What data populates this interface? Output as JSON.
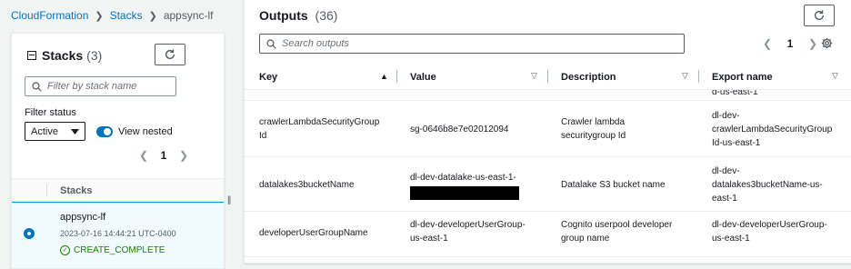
{
  "breadcrumb": {
    "root": "CloudFormation",
    "middle": "Stacks",
    "current": "appsync-lf"
  },
  "stacks_panel": {
    "title": "Stacks",
    "count": "(3)",
    "search_placeholder": "Filter by stack name",
    "filter_status_label": "Filter status",
    "filter_status_value": "Active",
    "view_nested_label": "View nested",
    "view_nested_on": true,
    "page_number": "1",
    "column_header": "Stacks",
    "selected_stack": {
      "name": "appsync-lf",
      "timestamp": "2023-07-16 14:44:21 UTC-0400",
      "status": "CREATE_COMPLETE"
    }
  },
  "outputs_panel": {
    "title": "Outputs",
    "count": "(36)",
    "search_placeholder": "Search outputs",
    "page_number": "1",
    "columns": {
      "key": "Key",
      "value": "Value",
      "description": "Description",
      "export_name": "Export name"
    },
    "partial_row_export": "d-us-east-1",
    "rows": [
      {
        "key": [
          "crawlerLambdaSecurityGroup",
          "Id"
        ],
        "value": [
          "sg-0646b8e7e02012094"
        ],
        "description": [
          "Crawler lambda",
          "securitygroup Id"
        ],
        "export_name": [
          "dl-dev-",
          "crawlerLambdaSecurityGroup",
          "Id-us-east-1"
        ]
      },
      {
        "key": [
          "datalakes3bucketName"
        ],
        "value": [
          "dl-dev-datalake-us-east-1-"
        ],
        "description": [
          "Datalake S3 bucket name"
        ],
        "export_name": [
          "dl-dev-",
          "datalakes3bucketName-us-",
          "east-1"
        ]
      },
      {
        "key": [
          "developerUserGroupName"
        ],
        "value": [
          "dl-dev-developerUserGroup-",
          "us-east-1"
        ],
        "description": [
          "Cognito userpool developer",
          "group name"
        ],
        "export_name": [
          "dl-dev-developerUserGroup-",
          "us-east-1"
        ]
      }
    ]
  },
  "colors": {
    "link": "#0073bb",
    "success": "#1d8102",
    "selected_bg": "#f1faff"
  }
}
